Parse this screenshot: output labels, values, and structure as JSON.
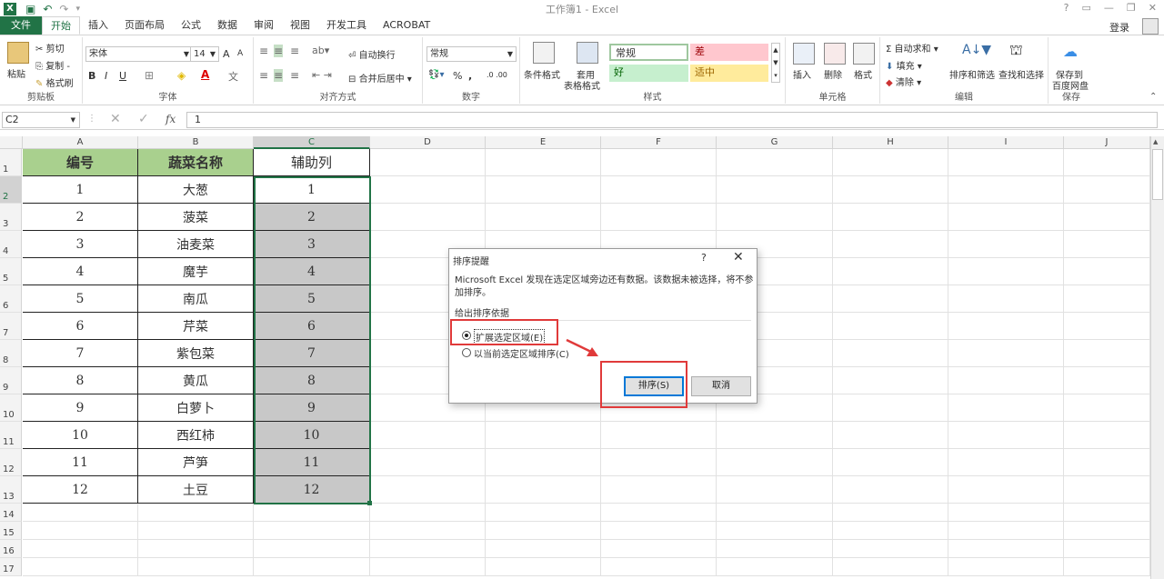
{
  "window": {
    "title": "工作簿1 - Excel",
    "help": "?",
    "login": "登录"
  },
  "menu": {
    "tabs": [
      "文件",
      "开始",
      "插入",
      "页面布局",
      "公式",
      "数据",
      "审阅",
      "视图",
      "开发工具",
      "ACROBAT"
    ]
  },
  "ribbon": {
    "clipboard": {
      "paste": "粘贴",
      "cut": "剪切",
      "copy": "复制 -",
      "format_painter": "格式刷",
      "label": "剪贴板"
    },
    "font": {
      "name": "宋体",
      "size": "14",
      "bold": "B",
      "italic": "I",
      "underline": "U",
      "label": "字体",
      "inc": "A",
      "dec": "A"
    },
    "align": {
      "wrap": "自动换行",
      "merge": "合并后居中",
      "label": "对齐方式"
    },
    "number": {
      "format": "常规",
      "percent": "%",
      "comma": ",",
      "label": "数字"
    },
    "styles": {
      "cond": "条件格式",
      "table": "套用",
      "table2": "表格格式",
      "normal": "常规",
      "bad": "差",
      "good": "好",
      "neutral": "适中",
      "label": "样式"
    },
    "cells": {
      "insert": "插入",
      "delete": "删除",
      "format": "格式",
      "label": "单元格"
    },
    "editing": {
      "autosum": "自动求和",
      "fill": "填充",
      "clear": "清除",
      "sort": "排序和筛选",
      "find": "查找和选择",
      "label": "编辑"
    },
    "save": {
      "line1": "保存到",
      "line2": "百度网盘",
      "label": "保存"
    }
  },
  "formula": {
    "namebox": "C2",
    "fx": "fx",
    "value": "1"
  },
  "sheet": {
    "columns": [
      "A",
      "B",
      "C",
      "D",
      "E",
      "F",
      "G",
      "H",
      "I",
      "J"
    ],
    "rows": [
      "1",
      "2",
      "3",
      "4",
      "5",
      "6",
      "7",
      "8",
      "9",
      "10",
      "11",
      "12",
      "13",
      "14",
      "15",
      "16",
      "17"
    ],
    "headers": [
      "编号",
      "蔬菜名称",
      "辅助列"
    ],
    "data": [
      [
        "1",
        "大葱",
        "1"
      ],
      [
        "2",
        "菠菜",
        "2"
      ],
      [
        "3",
        "油麦菜",
        "3"
      ],
      [
        "4",
        "魔芋",
        "4"
      ],
      [
        "5",
        "南瓜",
        "5"
      ],
      [
        "6",
        "芹菜",
        "6"
      ],
      [
        "7",
        "紫包菜",
        "7"
      ],
      [
        "8",
        "黄瓜",
        "8"
      ],
      [
        "9",
        "白萝卜",
        "9"
      ],
      [
        "10",
        "西红柿",
        "10"
      ],
      [
        "11",
        "芦笋",
        "11"
      ],
      [
        "12",
        "土豆",
        "12"
      ]
    ]
  },
  "dialog": {
    "title": "排序提醒",
    "help": "?",
    "close": "✕",
    "message": "Microsoft Excel 发现在选定区域旁边还有数据。该数据未被选择，将不参加排序。",
    "section": "给出排序依据",
    "option1": "扩展选定区域(E)",
    "option2": "以当前选定区域排序(C)",
    "sort_btn": "排序(S)",
    "cancel_btn": "取消"
  },
  "colors": {
    "excel_green": "#217346",
    "header_fill": "#a9d08e",
    "selection_fill": "#c8c8c8",
    "annotation_red": "#e03a3a"
  }
}
